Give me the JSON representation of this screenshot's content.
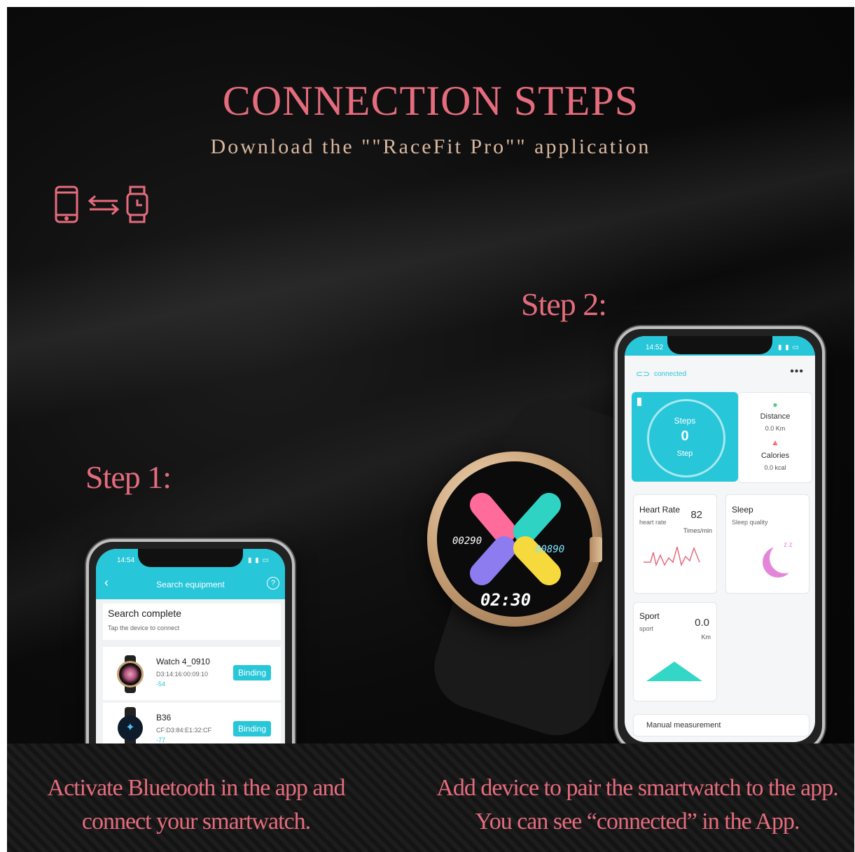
{
  "header": {
    "title": "CONNECTION STEPS",
    "subtitle": "Download the \"\"RaceFit Pro\"\" application"
  },
  "steps": {
    "step1_label": "Step 1:",
    "step2_label": "Step 2:",
    "step1_caption_line1": "Activate Bluetooth in the app and",
    "step1_caption_line2": "connect your smartwatch.",
    "step2_caption_line1": "Add device to pair the smartwatch to the app.",
    "step2_caption_line2": "You can see “connected” in the App."
  },
  "icons": [
    "phone-icon",
    "sync-arrows-icon",
    "watch-icon"
  ],
  "colors": {
    "accent": "#e56c7d",
    "subtitle": "#d9b8a0",
    "app_teal": "#27c6d9"
  },
  "phone1": {
    "time": "14:54",
    "nav_title": "Search equipment",
    "search_title": "Search complete",
    "search_hint": "Tap the device to connect",
    "devices": [
      {
        "name": "Watch 4_0910",
        "mac": "D3:14:16:00:09:10",
        "rssi": "-54",
        "action": "Binding"
      },
      {
        "name": "B36",
        "mac": "CF:D3:84:E1:32:CF",
        "rssi": "-77",
        "action": "Binding"
      }
    ]
  },
  "phone2": {
    "time": "14:52",
    "status": "connected",
    "steps_label": "Steps",
    "steps_value": "0",
    "steps_unit": "Step",
    "distance_label": "Distance",
    "distance_value": "0.0 Km",
    "calories_label": "Calories",
    "calories_value": "0.0 kcal",
    "heart_title": "Heart Rate",
    "heart_sub": "heart rate",
    "heart_value": "82",
    "heart_unit": "Times/min",
    "sleep_title": "Sleep",
    "sleep_sub": "Sleep quality",
    "sport_title": "Sport",
    "sport_sub": "sport",
    "sport_value": "0.0",
    "sport_unit": "Km",
    "manual": "Manual measurement"
  },
  "watch": {
    "steps": "00290",
    "distance": "00890",
    "time": "02:30"
  }
}
